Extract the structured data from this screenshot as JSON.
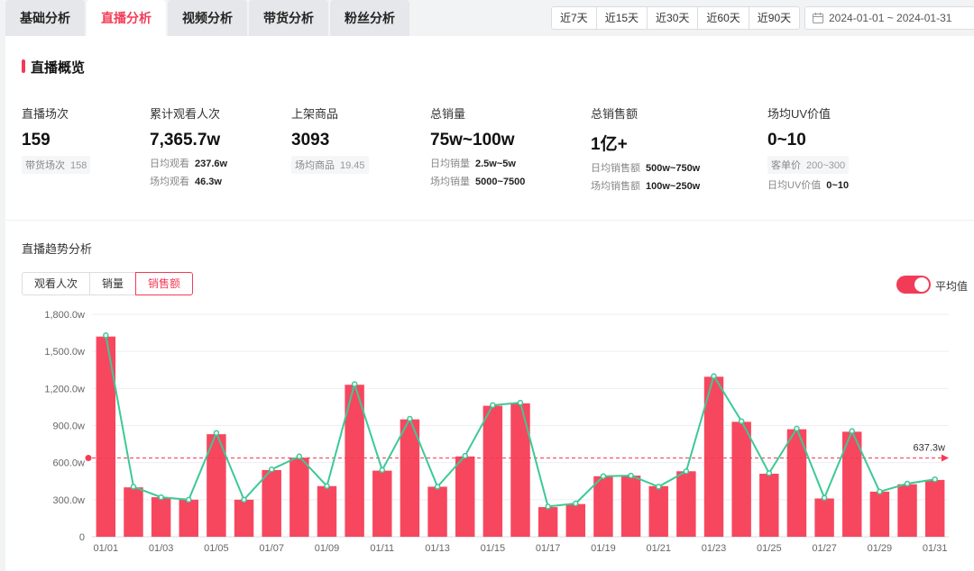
{
  "tabs": [
    "基础分析",
    "直播分析",
    "视频分析",
    "带货分析",
    "粉丝分析"
  ],
  "active_tab": 1,
  "ranges": [
    "近7天",
    "近15天",
    "近30天",
    "近60天",
    "近90天"
  ],
  "date_range": "2024-01-01 ~ 2024-01-31",
  "overview_title": "直播概览",
  "metrics": [
    {
      "label": "直播场次",
      "value": "159",
      "chip_label": "带货场次",
      "chip_value": "158"
    },
    {
      "label": "累计观看人次",
      "value": "7,365.7w",
      "sub1_label": "日均观看",
      "sub1_value": "237.6w",
      "sub2_label": "场均观看",
      "sub2_value": "46.3w"
    },
    {
      "label": "上架商品",
      "value": "3093",
      "chip_label": "场均商品",
      "chip_value": "19.45"
    },
    {
      "label": "总销量",
      "value": "75w~100w",
      "sub1_label": "日均销量",
      "sub1_value": "2.5w~5w",
      "sub2_label": "场均销量",
      "sub2_value": "5000~7500"
    },
    {
      "label": "总销售额",
      "value": "1亿+",
      "sub1_label": "日均销售额",
      "sub1_value": "500w~750w",
      "sub2_label": "场均销售额",
      "sub2_value": "100w~250w"
    },
    {
      "label": "场均UV价值",
      "value": "0~10",
      "chip_label": "客单价",
      "chip_value": "200~300",
      "sub2_label": "日均UV价值",
      "sub2_value": "0~10"
    }
  ],
  "trend_title": "直播趋势分析",
  "trend_toggles": [
    "观看人次",
    "销量",
    "销售额"
  ],
  "active_toggle": 2,
  "avg_switch_label": "平均值",
  "colors": {
    "accent": "#f23c57",
    "bar": "#f7475f",
    "line": "#3dc995"
  },
  "chart_data": {
    "type": "bar",
    "x": [
      "01/01",
      "01/02",
      "01/03",
      "01/04",
      "01/05",
      "01/06",
      "01/07",
      "01/08",
      "01/09",
      "01/10",
      "01/11",
      "01/12",
      "01/13",
      "01/14",
      "01/15",
      "01/16",
      "01/17",
      "01/18",
      "01/19",
      "01/20",
      "01/21",
      "01/22",
      "01/23",
      "01/24",
      "01/25",
      "01/26",
      "01/27",
      "01/28",
      "01/29",
      "01/30",
      "01/31"
    ],
    "x_tick_labels": [
      "01/01",
      "01/03",
      "01/05",
      "01/07",
      "01/09",
      "01/11",
      "01/13",
      "01/15",
      "01/17",
      "01/19",
      "01/21",
      "01/23",
      "01/25",
      "01/27",
      "01/29",
      "01/31"
    ],
    "bar_values": [
      1620,
      400,
      320,
      300,
      830,
      300,
      540,
      640,
      410,
      1230,
      535,
      950,
      405,
      650,
      1060,
      1080,
      240,
      265,
      490,
      495,
      410,
      530,
      1295,
      930,
      510,
      870,
      310,
      850,
      365,
      425,
      460
    ],
    "line_values": [
      1630,
      405,
      320,
      300,
      840,
      300,
      545,
      650,
      410,
      1235,
      540,
      955,
      405,
      655,
      1065,
      1085,
      245,
      270,
      490,
      495,
      405,
      530,
      1300,
      935,
      515,
      875,
      315,
      855,
      365,
      430,
      465
    ],
    "y_ticks": [
      "0",
      "300.0w",
      "600.0w",
      "900.0w",
      "1,200.0w",
      "1,500.0w",
      "1,800.0w"
    ],
    "ylim": [
      0,
      1800
    ],
    "average": 637.3,
    "average_label": "637.3w",
    "grid": true
  }
}
